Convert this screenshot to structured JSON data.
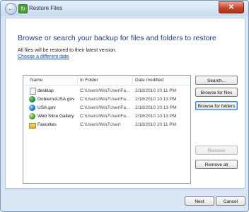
{
  "window": {
    "title": "Restore Files",
    "back_glyph": "←",
    "close_glyph": "✕",
    "icons": {
      "back": "back-arrow-icon",
      "app": "restore-files-icon",
      "close": "close-icon"
    }
  },
  "main": {
    "heading": "Browse or search your backup for files and folders to restore",
    "info": "All files will be restored to their latest version.",
    "change_date_link": "Choose a different date"
  },
  "list": {
    "columns": {
      "name": "Name",
      "folder": "In Folder",
      "date": "Date modified"
    },
    "rows": [
      {
        "name": "desktop",
        "folder": "C:\\Users\\Win7User\\Fa...",
        "date": "2/18/2010 10:11 PM",
        "icon": "desktop-file-icon"
      },
      {
        "name": "GobiernoUSA.gov",
        "folder": "C:\\Users\\Win7User\\Fa...",
        "date": "2/18/2010 10:13 PM",
        "icon": "ie-favorite-icon"
      },
      {
        "name": "USA.gov",
        "folder": "C:\\Users\\Win7User\\Fa...",
        "date": "2/18/2010 10:13 PM",
        "icon": "ie-favorite-icon"
      },
      {
        "name": "Web Slice Gallery",
        "folder": "C:\\Users\\Win7User\\Fa...",
        "date": "2/18/2010 10:13 PM",
        "icon": "web-slice-icon"
      },
      {
        "name": "Favorites",
        "folder": "C:\\Users\\Win7User\\",
        "date": "2/18/2010 10:11 PM",
        "icon": "folder-icon"
      }
    ]
  },
  "buttons": {
    "search": "Search...",
    "browse_files": "Browse for files",
    "browse_folders": "Browse for folders",
    "remove": "Remove",
    "remove_all": "Remove all",
    "next": "Next",
    "cancel": "Cancel"
  }
}
